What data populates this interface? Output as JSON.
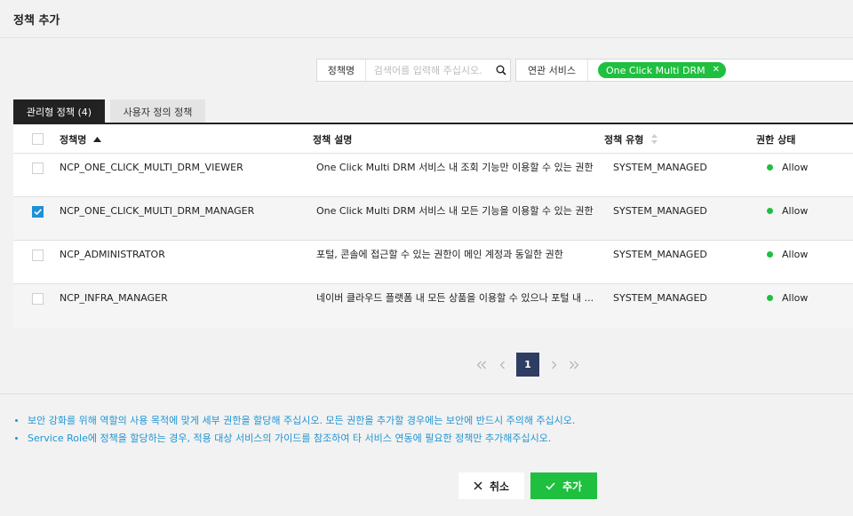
{
  "header": {
    "title": "정책 추가"
  },
  "search": {
    "label": "정책명",
    "placeholder": "검색어를 입력해 주십시오."
  },
  "service_filter": {
    "label": "연관 서비스",
    "chip": "One Click Multi DRM"
  },
  "tabs": [
    {
      "label": "관리형 정책 (4)",
      "active": true
    },
    {
      "label": "사용자 정의 정책",
      "active": false
    }
  ],
  "table": {
    "columns": [
      "정책명",
      "정책 설명",
      "정책 유형",
      "권한 상태"
    ],
    "rows": [
      {
        "checked": false,
        "name": "NCP_ONE_CLICK_MULTI_DRM_VIEWER",
        "description": "One Click Multi DRM 서비스 내 조회 기능만 이용할 수 있는 권한",
        "type": "SYSTEM_MANAGED",
        "status": "Allow"
      },
      {
        "checked": true,
        "name": "NCP_ONE_CLICK_MULTI_DRM_MANAGER",
        "description": "One Click Multi DRM 서비스 내 모든 기능을 이용할 수 있는 권한",
        "type": "SYSTEM_MANAGED",
        "status": "Allow"
      },
      {
        "checked": false,
        "name": "NCP_ADMINISTRATOR",
        "description": "포털, 콘솔에 접근할 수 있는 권한이 메인 계정과 동일한 권한",
        "type": "SYSTEM_MANAGED",
        "status": "Allow"
      },
      {
        "checked": false,
        "name": "NCP_INFRA_MANAGER",
        "description": "네이버 클라우드 플랫폼 내 모든 상품을 이용할 수 있으나 포털 내 ...",
        "type": "SYSTEM_MANAGED",
        "status": "Allow"
      }
    ]
  },
  "pagination": {
    "current_page": "1"
  },
  "notes": [
    "보안 강화를 위해 역할의 사용 목적에 맞게 세부 권한을 할당해 주십시오. 모든 권한을 추가할 경우에는 보안에 반드시 주의해 주십시오.",
    "Service Role에 정책을 할당하는 경우, 적용 대상 서비스의 가이드를 참조하여 타 서비스 연동에 필요한 정책만 추가해주십시오."
  ],
  "buttons": {
    "cancel": "취소",
    "add": "추가"
  },
  "colors": {
    "accent_green": "#1fbf3f",
    "info_blue": "#1f95d3",
    "check_blue": "#1e90d8",
    "pager_navy": "#2f3d63"
  },
  "icons": [
    "search-icon",
    "chip-close-icon",
    "sort-asc-icon",
    "sort-icon",
    "first-page-icon",
    "prev-page-icon",
    "next-page-icon",
    "last-page-icon",
    "close-icon",
    "check-icon",
    "status-dot-icon"
  ]
}
